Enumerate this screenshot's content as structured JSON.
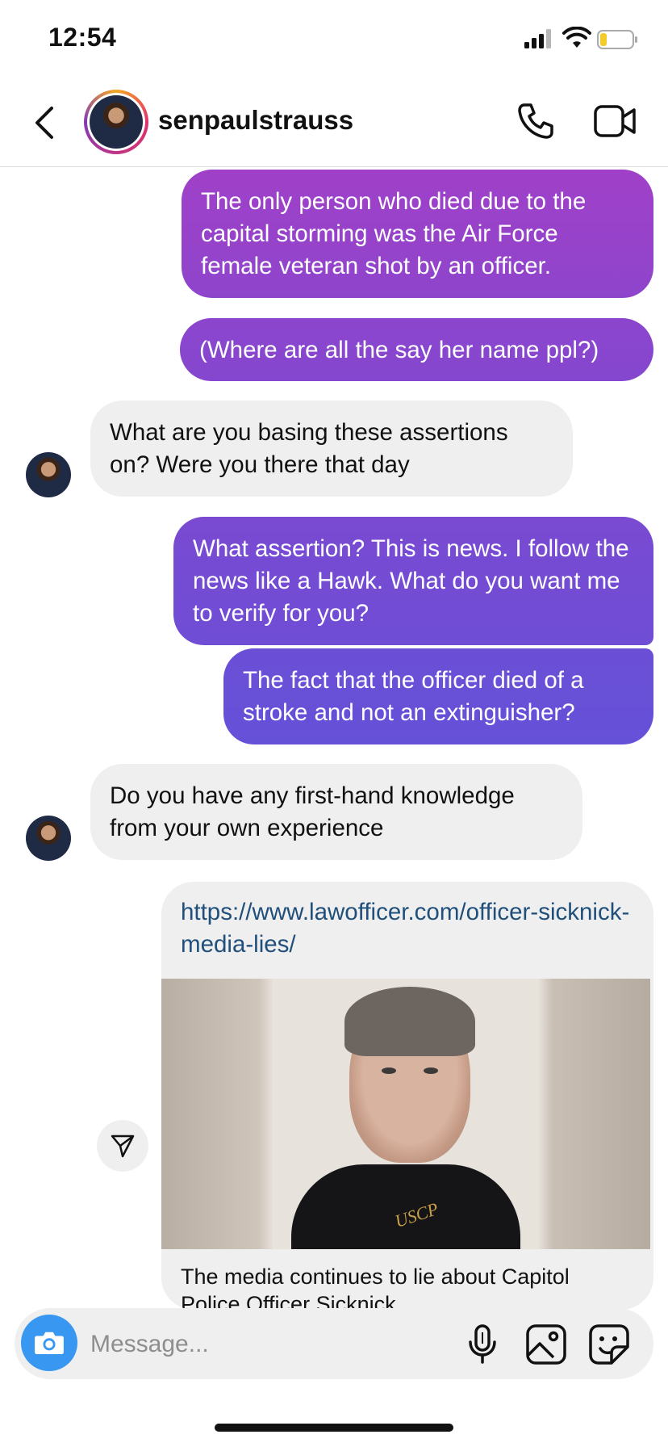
{
  "status_bar": {
    "time": "12:54"
  },
  "header": {
    "username": "senpaulstrauss"
  },
  "messages": [
    {
      "from": "me",
      "text": "The only person who died due to the capital storming was the Air Force female veteran shot by an officer."
    },
    {
      "from": "me",
      "text": "(Where are all the say her name ppl?)"
    },
    {
      "from": "them",
      "text": "What are you basing these assertions on? Were you there that day"
    },
    {
      "from": "me",
      "text": "What assertion? This is news. I follow the news like a Hawk. What do you want me to verify for you?"
    },
    {
      "from": "me",
      "text": "The fact that the officer died of a stroke and not an extinguisher?"
    },
    {
      "from": "them",
      "text": "Do you have any first-hand knowledge from your own experience"
    }
  ],
  "link_card": {
    "url": "https://www.lawofficer.com/officer-sicknick-media-lies/",
    "title": "The media continues to lie about Capitol Police Officer Sicknick",
    "image_text": "USCP"
  },
  "composer": {
    "placeholder": "Message..."
  },
  "colors": {
    "bubble_top": "#9b3fc9",
    "bubble_bottom": "#6b4fd6",
    "incoming": "#efefef",
    "camera": "#3897f0",
    "link": "#1f4f7a"
  },
  "icons": [
    "back-icon",
    "phone-icon",
    "video-icon",
    "send-icon",
    "camera-icon",
    "mic-icon",
    "gallery-icon",
    "sticker-icon"
  ]
}
